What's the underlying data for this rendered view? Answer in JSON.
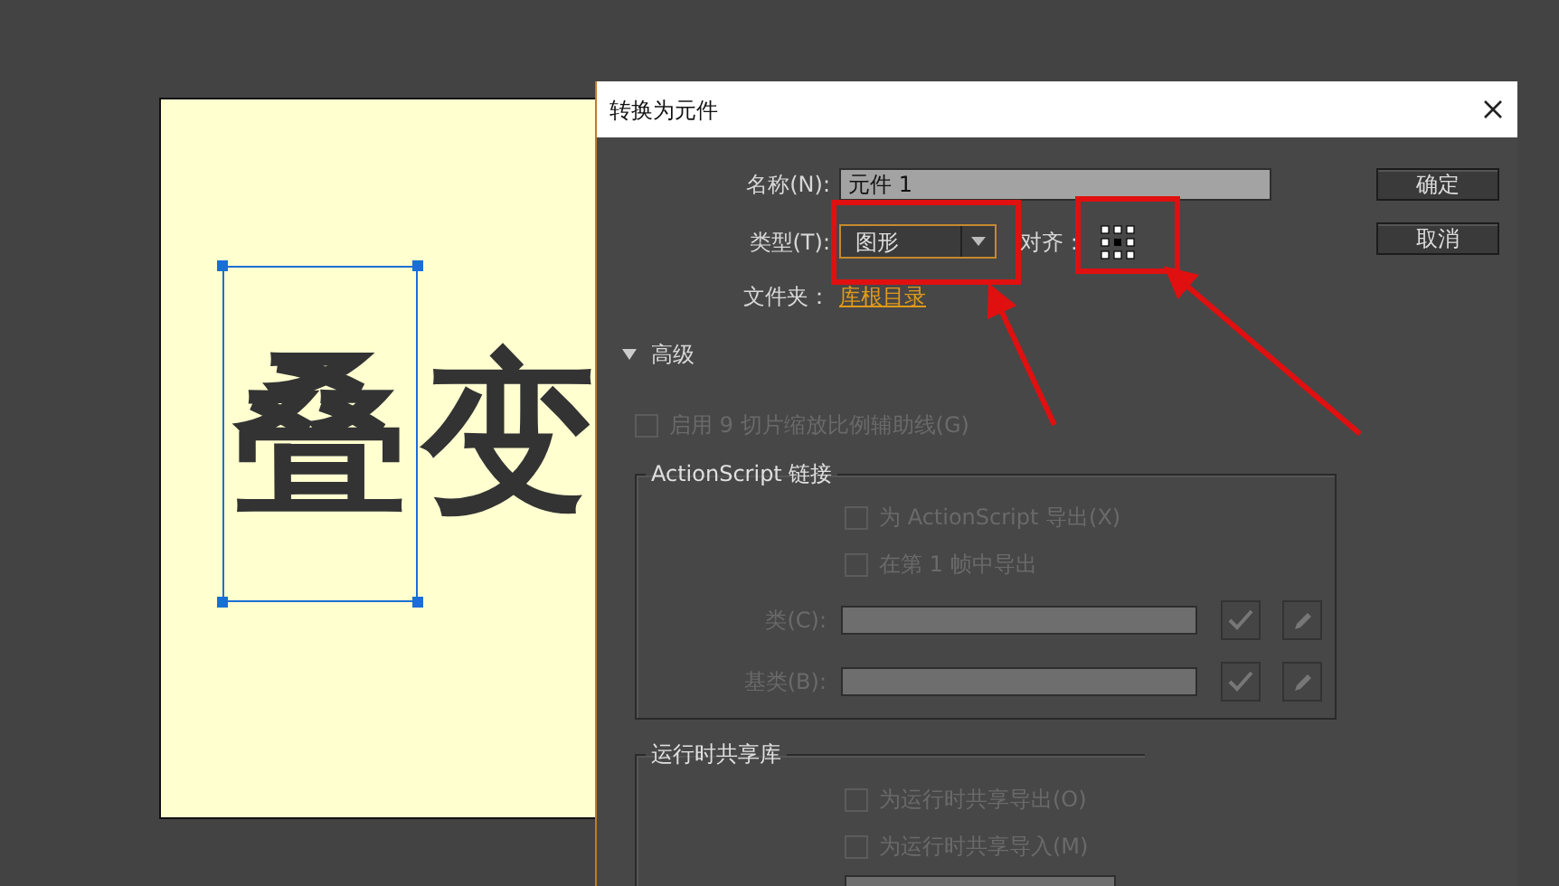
{
  "canvas": {
    "glyphs": [
      {
        "text": "叠",
        "selected": true
      },
      {
        "text": "变",
        "selected": false
      }
    ]
  },
  "dialog": {
    "title": "转换为元件",
    "name": {
      "label": "名称(N):",
      "value": "元件 1"
    },
    "type": {
      "label": "类型(T):",
      "value": "图形"
    },
    "align": {
      "label": "对齐："
    },
    "folder": {
      "label": "文件夹：",
      "link": "库根目录"
    },
    "buttons": [
      "确定",
      "取消"
    ],
    "advanced": {
      "label": "高级",
      "expanded": true
    },
    "slice_guides": {
      "label": "启用 9 切片缩放比例辅助线(G)",
      "checked": false,
      "disabled": true
    },
    "actionscript": {
      "title": "ActionScript 链接",
      "checkboxes": [
        {
          "label": "为 ActionScript 导出(X)",
          "checked": false,
          "disabled": true
        },
        {
          "label": "在第 1 帧中导出",
          "checked": false,
          "disabled": true
        }
      ],
      "fields": [
        {
          "label": "类(C):",
          "disabled": true
        },
        {
          "label": "基类(B):",
          "disabled": true
        }
      ]
    },
    "runtime": {
      "title": "运行时共享库",
      "checkboxes": [
        {
          "label": "为运行时共享导出(O)",
          "checked": false,
          "disabled": true
        },
        {
          "label": "为运行时共享导入(M)",
          "checked": false,
          "disabled": true
        }
      ]
    }
  }
}
